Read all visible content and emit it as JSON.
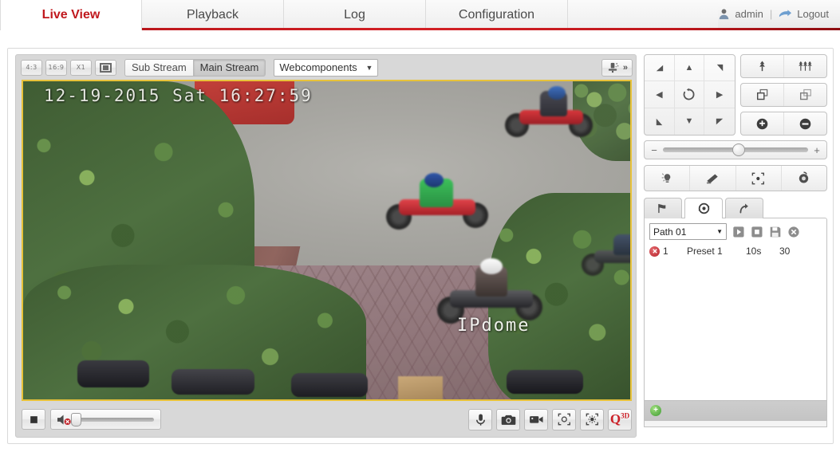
{
  "header": {
    "tabs": [
      {
        "label": "Live View",
        "active": true
      },
      {
        "label": "Playback",
        "active": false
      },
      {
        "label": "Log",
        "active": false
      },
      {
        "label": "Configuration",
        "active": false
      }
    ],
    "user": {
      "name": "admin",
      "separator": "|",
      "logout_label": "Logout",
      "user_icon": "user-icon",
      "logout_icon": "logout-arrow-icon"
    },
    "accent_color": "#c0181d",
    "underline_color": "#b31217"
  },
  "video_toolbar": {
    "ratio_buttons": [
      {
        "label": "4:3",
        "name": "aspect-4-3"
      },
      {
        "label": "16:9",
        "name": "aspect-16-9"
      },
      {
        "label": "X1",
        "name": "aspect-original"
      }
    ],
    "fullscreen_label": "",
    "streams": [
      {
        "label": "Sub Stream",
        "selected": false
      },
      {
        "label": "Main Stream",
        "selected": true
      }
    ],
    "plugin": {
      "value": "Webcomponents",
      "caret": "▼"
    },
    "lens_expand": {
      "icon": "lens-icon",
      "chevron": "»"
    }
  },
  "video": {
    "timestamp_overlay": "12-19-2015 Sat 16:27:59",
    "camera_name_overlay": "IPdome",
    "border_color": "#e8c23a"
  },
  "player_bar": {
    "stop": {
      "name": "stop-button",
      "icon": "stop-square-icon"
    },
    "audio": {
      "name": "mute-toggle",
      "icon": "speaker-muted-icon",
      "volume": 0
    },
    "right_buttons": [
      {
        "name": "microphone-button",
        "icon": "microphone-icon"
      },
      {
        "name": "snapshot-button",
        "icon": "camera-icon"
      },
      {
        "name": "record-button",
        "icon": "video-camera-icon"
      },
      {
        "name": "digital-zoom-button",
        "icon": "digital-zoom-icon"
      },
      {
        "name": "image-adjust-button",
        "icon": "brightness-icon"
      },
      {
        "name": "3d-positioning-button",
        "icon": "q3d-icon",
        "label": "Q",
        "sup": "3D"
      }
    ]
  },
  "ptz": {
    "dpad": [
      {
        "name": "pan-up-left",
        "glyph": "◢"
      },
      {
        "name": "pan-up",
        "glyph": "▲"
      },
      {
        "name": "pan-up-right",
        "glyph": "◣"
      },
      {
        "name": "pan-left",
        "glyph": "◀"
      },
      {
        "name": "auto-scan",
        "glyph": "↻"
      },
      {
        "name": "pan-right",
        "glyph": "▶"
      },
      {
        "name": "pan-down-left",
        "glyph": "◥"
      },
      {
        "name": "pan-down",
        "glyph": "▼"
      },
      {
        "name": "pan-down-right",
        "glyph": "◤"
      }
    ],
    "zoom_focus": [
      {
        "name": "zoom-in-button",
        "icon": "zoom-in-tree-icon"
      },
      {
        "name": "zoom-out-button",
        "icon": "zoom-out-trees-icon"
      },
      {
        "name": "focus-near-button",
        "icon": "focus-near-icon"
      },
      {
        "name": "focus-far-button",
        "icon": "focus-far-icon"
      },
      {
        "name": "iris-open-button",
        "icon": "iris-plus-icon"
      },
      {
        "name": "iris-close-button",
        "icon": "iris-minus-icon"
      }
    ],
    "speed": {
      "minus": "−",
      "plus": "+",
      "value": 48
    },
    "aux_buttons": [
      {
        "name": "light-button",
        "icon": "light-bulb-icon"
      },
      {
        "name": "wiper-button",
        "icon": "wiper-icon"
      },
      {
        "name": "auxiliary-focus-button",
        "icon": "auto-focus-icon"
      },
      {
        "name": "lens-initialization-button",
        "icon": "lens-init-icon"
      }
    ],
    "tabs": [
      {
        "name": "preset-tab",
        "icon": "flag-icon",
        "active": false
      },
      {
        "name": "patrol-tab",
        "icon": "patrol-circle-icon",
        "active": true
      },
      {
        "name": "pattern-tab",
        "icon": "pattern-arrow-icon",
        "active": false
      }
    ],
    "patrol": {
      "path_select": {
        "value": "Path 01",
        "caret": "▼"
      },
      "actions": [
        {
          "name": "start-patrol-button",
          "icon": "play-icon"
        },
        {
          "name": "stop-patrol-button",
          "icon": "stop-icon"
        },
        {
          "name": "save-patrol-button",
          "icon": "save-icon"
        },
        {
          "name": "delete-patrol-button",
          "icon": "delete-circle-icon"
        }
      ],
      "rows": [
        {
          "delete_icon": "delete-row-icon",
          "number": "1",
          "preset": "Preset 1",
          "dwell": "10s",
          "speed": "30"
        }
      ],
      "add_button": {
        "name": "add-patrol-point-button",
        "glyph": "+"
      }
    }
  }
}
